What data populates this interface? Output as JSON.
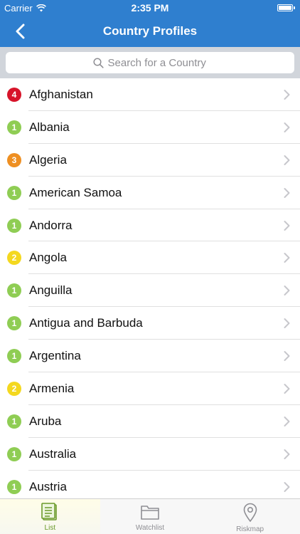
{
  "status_bar": {
    "carrier": "Carrier",
    "time": "2:35 PM"
  },
  "nav": {
    "title": "Country Profiles"
  },
  "search": {
    "placeholder": "Search for a Country"
  },
  "risk_colors": {
    "1": "#8fcd54",
    "2": "#f4d81f",
    "3": "#ee8f22",
    "4": "#d7142a"
  },
  "countries": [
    {
      "name": "Afghanistan",
      "risk": "4"
    },
    {
      "name": "Albania",
      "risk": "1"
    },
    {
      "name": "Algeria",
      "risk": "3"
    },
    {
      "name": "American Samoa",
      "risk": "1"
    },
    {
      "name": "Andorra",
      "risk": "1"
    },
    {
      "name": "Angola",
      "risk": "2"
    },
    {
      "name": "Anguilla",
      "risk": "1"
    },
    {
      "name": "Antigua and Barbuda",
      "risk": "1"
    },
    {
      "name": "Argentina",
      "risk": "1"
    },
    {
      "name": "Armenia",
      "risk": "2"
    },
    {
      "name": "Aruba",
      "risk": "1"
    },
    {
      "name": "Australia",
      "risk": "1"
    },
    {
      "name": "Austria",
      "risk": "1"
    }
  ],
  "tabs": [
    {
      "label": "List",
      "icon": "list-icon",
      "active": true
    },
    {
      "label": "Watchlist",
      "icon": "folder-icon",
      "active": false
    },
    {
      "label": "Riskmap",
      "icon": "map-pin-icon",
      "active": false
    }
  ]
}
